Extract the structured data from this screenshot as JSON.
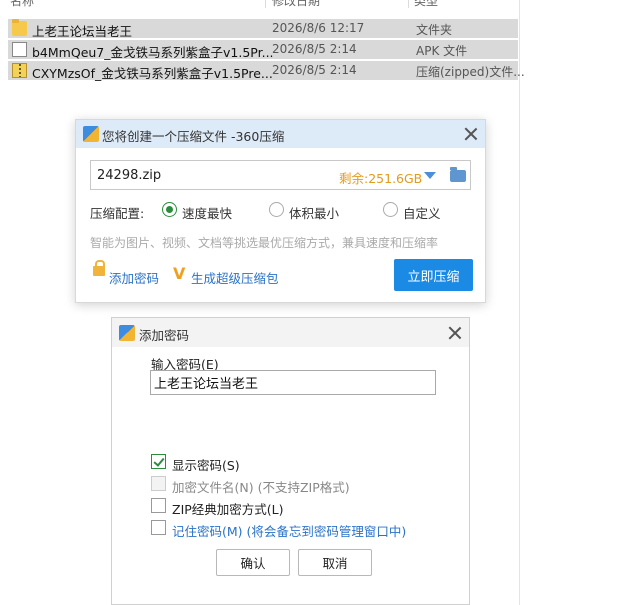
{
  "explorer": {
    "headers": {
      "name": "名称",
      "date": "修改日期",
      "type": "类型"
    },
    "rows": [
      {
        "icon": "folder-icon",
        "name": "上老王论坛当老王",
        "date": "2026/8/6 12:17",
        "type": "文件夹"
      },
      {
        "icon": "file-icon",
        "name": "b4MmQeu7_金戈铁马系列紫盒子v1.5Pr...",
        "date": "2026/8/5 2:14",
        "type": "APK 文件"
      },
      {
        "icon": "zip-icon",
        "name": "CXYMzsOf_金戈铁马系列紫盒子v1.5Pre...",
        "date": "2026/8/5 2:14",
        "type": "压缩(zipped)文件..."
      }
    ]
  },
  "compress_dialog": {
    "title": "您将创建一个压缩文件 -360压缩",
    "filename": "24298.zip",
    "free_space": "剩余:251.6GB",
    "config_label": "压缩配置:",
    "options": [
      {
        "label": "速度最快",
        "selected": true
      },
      {
        "label": "体积最小",
        "selected": false
      },
      {
        "label": "自定义",
        "selected": false
      }
    ],
    "hint": "智能为图片、视频、文档等挑选最优压缩方式，兼具速度和压缩率",
    "add_password_link": "添加密码",
    "super_package_link": "生成超级压缩包",
    "compress_button": "立即压缩",
    "accent_color": "#1a8ae5"
  },
  "password_dialog": {
    "title": "添加密码",
    "input_label": "输入密码(E)",
    "password_value": "上老王论坛当老王",
    "checkboxes": [
      {
        "label": "显示密码(S)",
        "checked": true,
        "enabled": true
      },
      {
        "label": "加密文件名(N) (不支持ZIP格式)",
        "checked": false,
        "enabled": false
      },
      {
        "label": "ZIP经典加密方式(L)",
        "checked": false,
        "enabled": true
      },
      {
        "label": "记住密码(M) (将会备忘到密码管理窗口中)",
        "checked": false,
        "enabled": true
      }
    ],
    "ok_button": "确认",
    "cancel_button": "取消"
  }
}
